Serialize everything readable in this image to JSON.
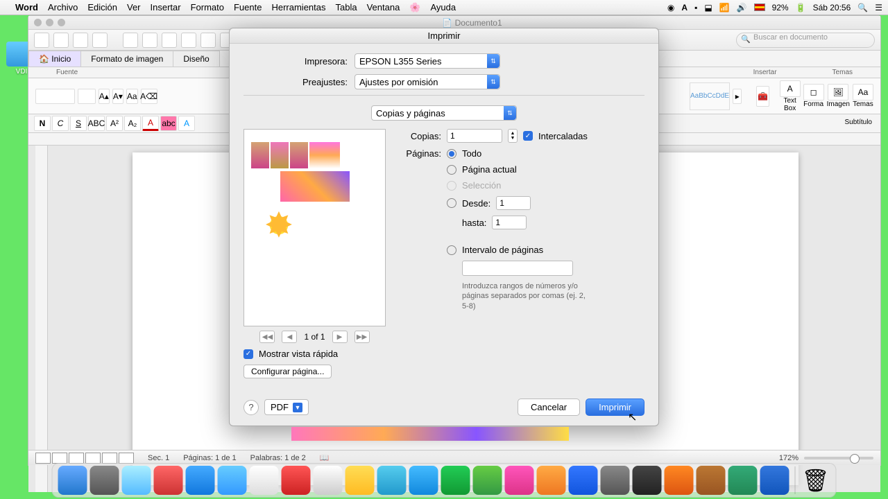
{
  "menubar": {
    "app": "Word",
    "items": [
      "Archivo",
      "Edición",
      "Ver",
      "Insertar",
      "Formato",
      "Fuente",
      "Herramientas",
      "Tabla",
      "Ventana"
    ],
    "help": "Ayuda",
    "battery": "92%",
    "clock": "Sáb 20:56"
  },
  "window": {
    "doctitle": "Documento1",
    "search_placeholder": "Buscar en documento",
    "tabs": {
      "home": "Inicio",
      "format_image": "Formato de imagen",
      "design": "Diseño"
    },
    "group_font": "Fuente",
    "group_insert": "Insertar",
    "group_themes": "Temas",
    "style_subtitle": "Subtítulo",
    "style_sample": "AaBbCcDdE",
    "insert_textbox": "Text Box",
    "insert_shape": "Forma",
    "insert_image": "Imagen",
    "insert_themes": "Temas"
  },
  "statusbar": {
    "sec_label": "Sec.",
    "sec_val": "1",
    "pages_label": "Páginas:",
    "pages_val": "1 de 1",
    "words_label": "Palabras:",
    "words_val": "1 de 2",
    "zoom": "172%"
  },
  "dialog": {
    "title": "Imprimir",
    "printer_label": "Impresora:",
    "printer_value": "EPSON L355 Series",
    "presets_label": "Preajustes:",
    "presets_value": "Ajustes por omisión",
    "section": "Copias y páginas",
    "copies_label": "Copias:",
    "copies_value": "1",
    "collated": "Intercaladas",
    "pages_label": "Páginas:",
    "radio_all": "Todo",
    "radio_current": "Página actual",
    "radio_selection": "Selección",
    "radio_from": "Desde:",
    "from_value": "1",
    "to_label": "hasta:",
    "to_value": "1",
    "radio_range": "Intervalo de páginas",
    "range_hint": "Introduzca rangos de números y/o páginas separados por comas (ej. 2, 5-8)",
    "preview_counter": "1 of 1",
    "quick_preview": "Mostrar vista rápida",
    "page_setup": "Configurar página...",
    "pdf": "PDF",
    "cancel": "Cancelar",
    "print": "Imprimir"
  },
  "desktop": {
    "icon_label": "VDI"
  }
}
